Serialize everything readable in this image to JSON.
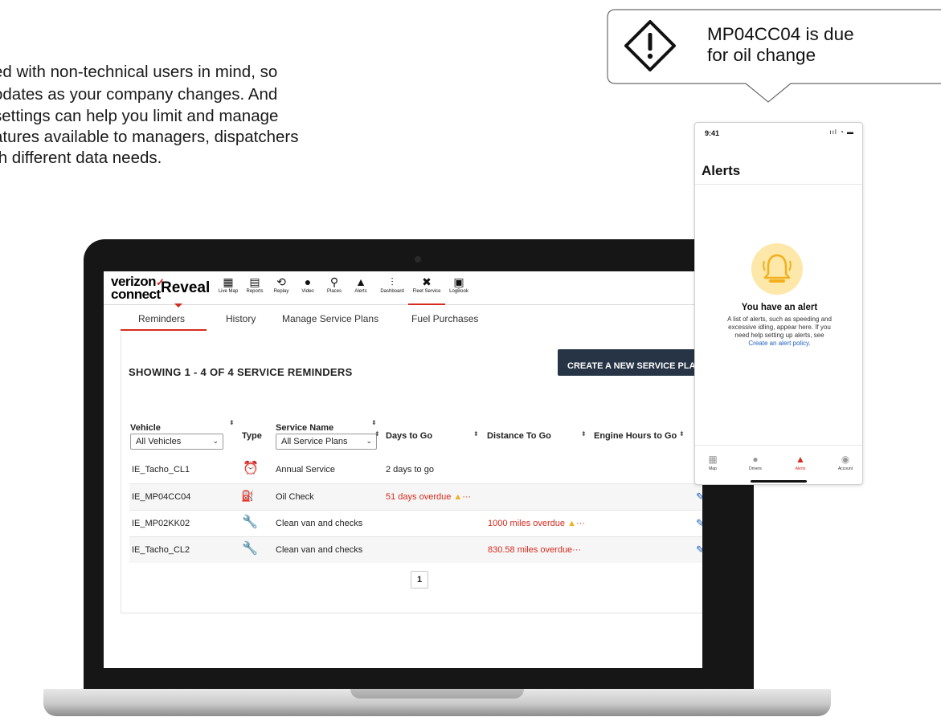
{
  "intro": {
    "lines": [
      "ed with non-technical users in mind, so",
      "odates as your company changes. And",
      " settings can help you limit and manage",
      "atures available to managers, dispatchers",
      "th different data needs."
    ]
  },
  "callout": {
    "line1": "MP04CC04 is due",
    "line2": "for oil change",
    "icon": "warning-diamond-icon"
  },
  "app": {
    "brand_line1": "verizon",
    "brand_check": "✓",
    "brand_line2": "connect",
    "product": "Reveal",
    "nav": [
      {
        "label": "Live Map",
        "icon": "map-icon"
      },
      {
        "label": "Reports",
        "icon": "report-icon"
      },
      {
        "label": "Replay",
        "icon": "replay-icon"
      },
      {
        "label": "Video",
        "icon": "video-icon"
      },
      {
        "label": "Places",
        "icon": "places-icon"
      },
      {
        "label": "Alerts",
        "icon": "alert-icon"
      },
      {
        "label": "Dashboard",
        "icon": "dashboard-icon"
      },
      {
        "label": "Fleet Service",
        "icon": "wrench-icon"
      },
      {
        "label": "LogBook",
        "icon": "logbook-icon"
      }
    ],
    "active_nav": "Fleet Service",
    "subtabs": [
      "Reminders",
      "History",
      "Manage Service Plans",
      "Fuel Purchases"
    ],
    "active_subtab": "Reminders",
    "showing_text": "SHOWING 1 - 4 OF 4 SERVICE REMINDERS",
    "create_button": "CREATE A NEW SERVICE PLA",
    "columns": {
      "vehicle": "Vehicle",
      "type": "Type",
      "service_name": "Service Name",
      "days_to_go": "Days to Go",
      "distance_to_go": "Distance To Go",
      "engine_hours": "Engine Hours to Go"
    },
    "filters": {
      "vehicle": "All Vehicles",
      "service_plans": "All Service Plans"
    },
    "rows": [
      {
        "vehicle": "IE_Tacho_CL1",
        "type_icon": "clock-icon",
        "service": "Annual Service",
        "days": "2 days to go",
        "distance": "",
        "warn": false
      },
      {
        "vehicle": "IE_MP04CC04",
        "type_icon": "oil-can-icon",
        "service": "Oil Check",
        "days": "51 days overdue",
        "distance": "",
        "warn": true
      },
      {
        "vehicle": "IE_MP02KK02",
        "type_icon": "wrench-p-icon",
        "service": "Clean van and checks",
        "days": "",
        "distance": "1000 miles overdue",
        "warn": true
      },
      {
        "vehicle": "IE_Tacho_CL2",
        "type_icon": "wrench-p-icon",
        "service": "Clean van and checks",
        "days": "",
        "distance": "830.58 miles overdue",
        "warn": false
      }
    ],
    "page": "1",
    "colors": {
      "accent": "#d52b1e",
      "button": "#273445",
      "link": "#1f5fbf",
      "warning": "#f2b01e"
    }
  },
  "phone": {
    "time": "9:41",
    "title": "Alerts",
    "alert_title": "You have an alert",
    "desc_line1": "A list of alerts, such as speeding and",
    "desc_line2": "excessive idling, appear here. If you",
    "desc_line3": "need help setting up alerts, see",
    "link": "Create an alert policy.",
    "tabs": [
      {
        "label": "Map",
        "icon": "map-icon"
      },
      {
        "label": "Drivers",
        "icon": "person-icon"
      },
      {
        "label": "Alerts",
        "icon": "alert-icon"
      },
      {
        "label": "Account",
        "icon": "account-icon"
      }
    ],
    "active_tab": "Alerts"
  }
}
